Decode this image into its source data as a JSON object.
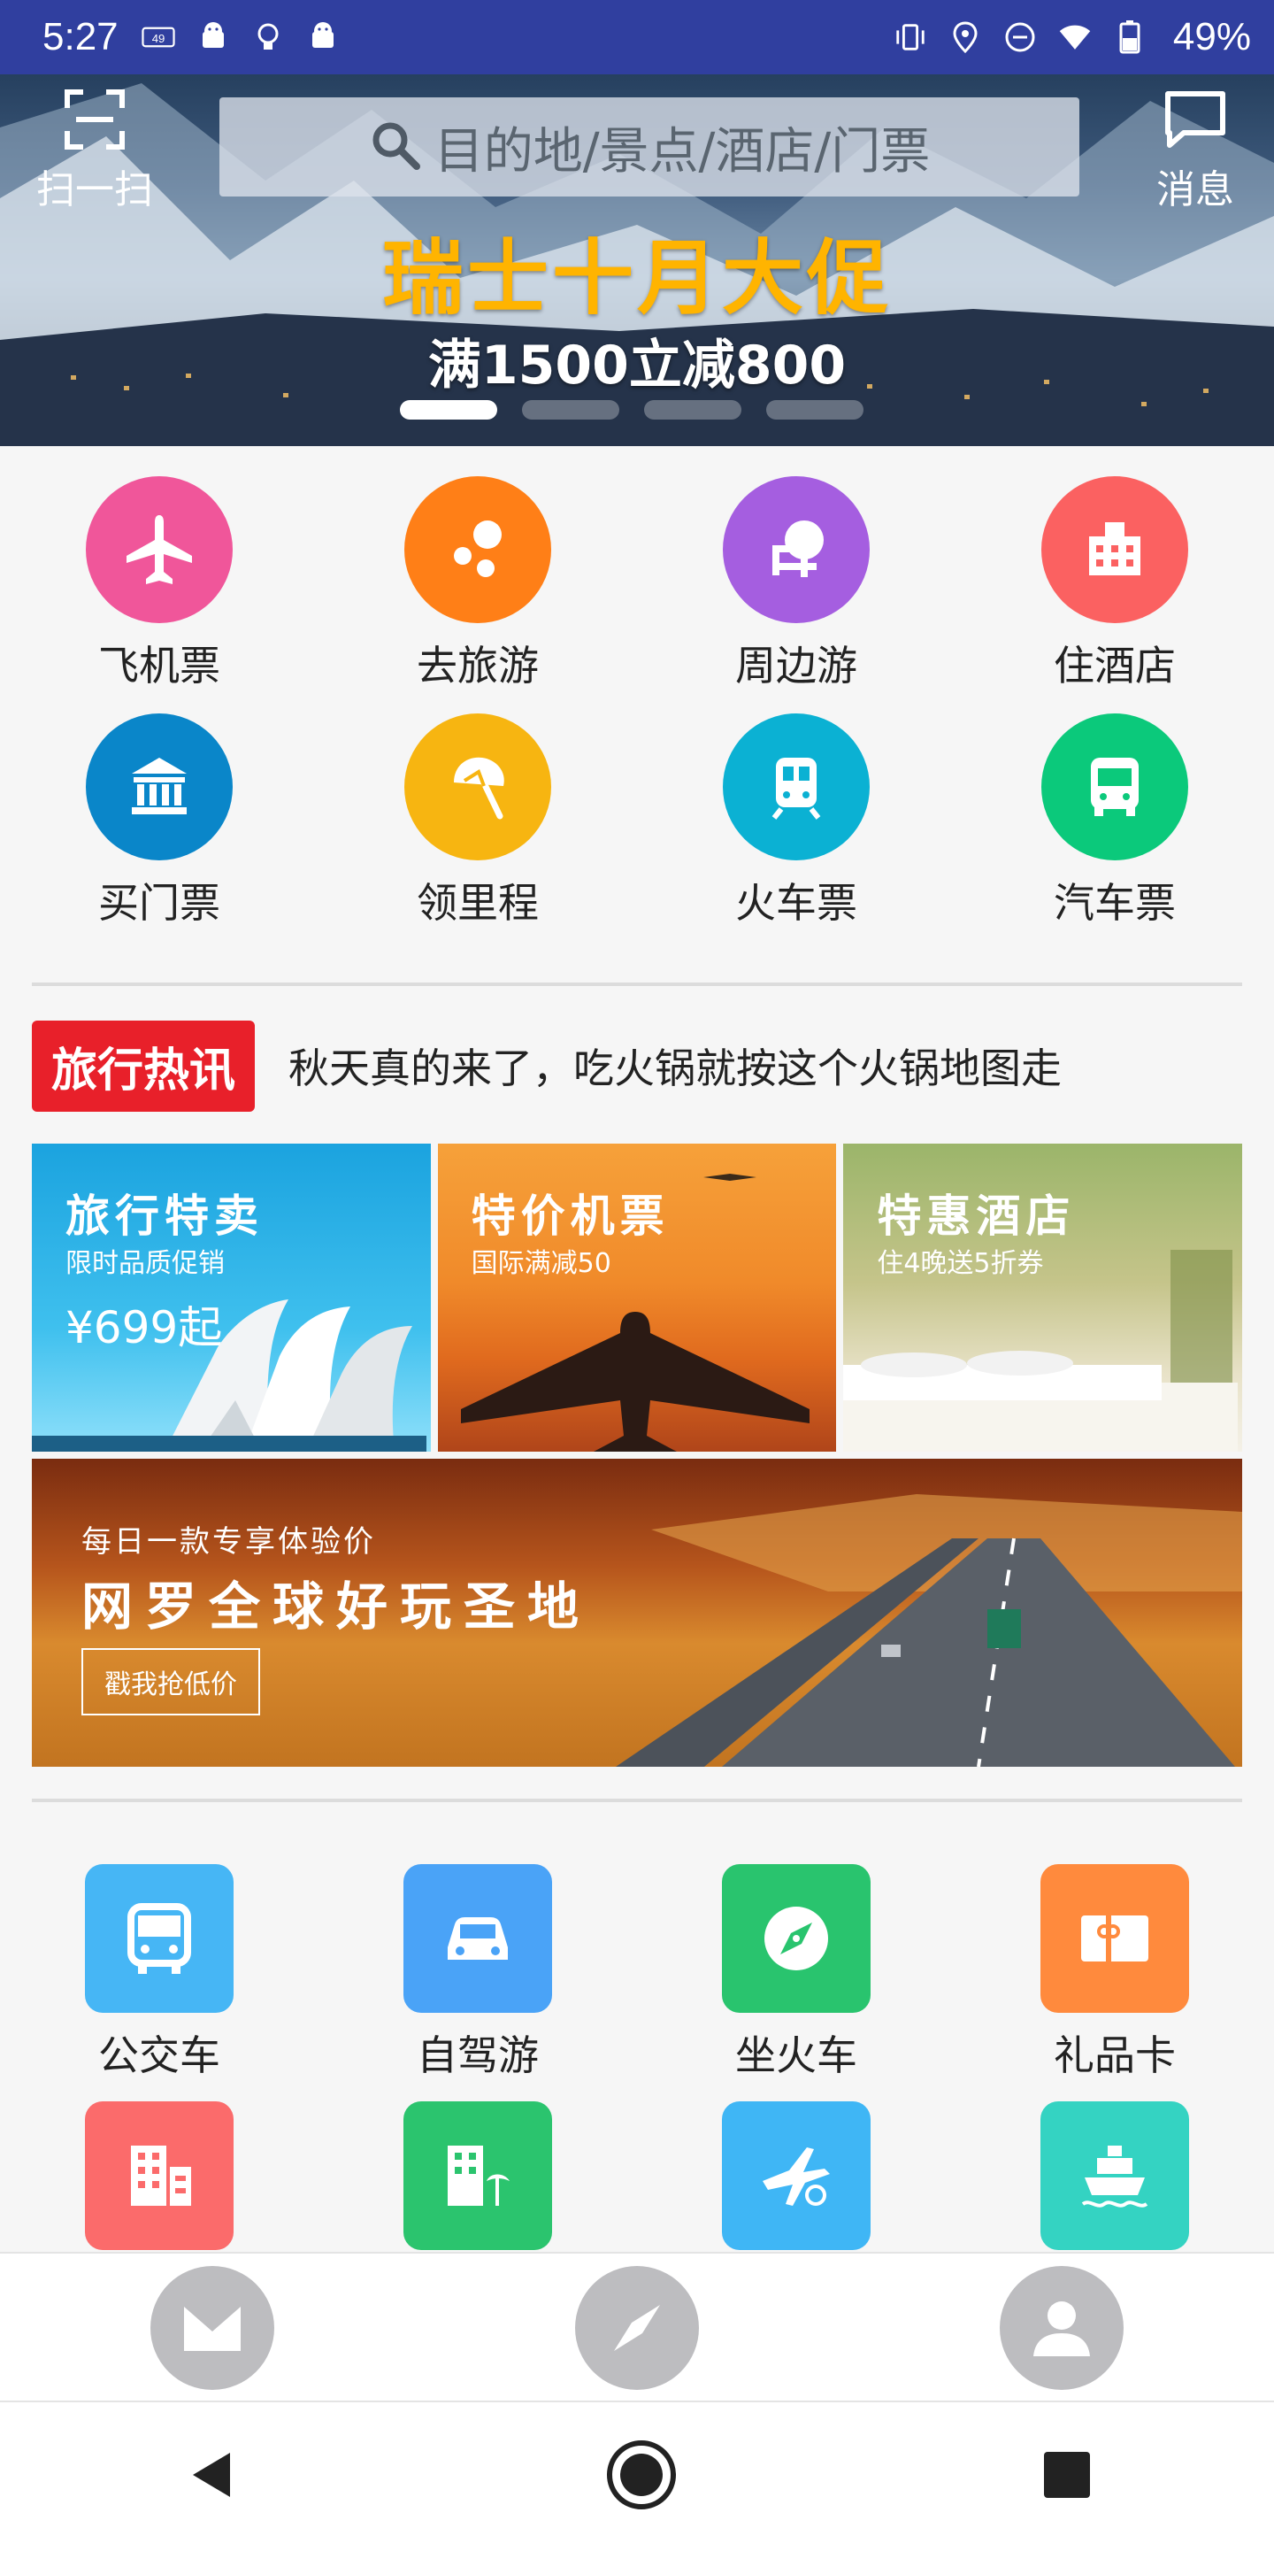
{
  "status_bar": {
    "time": "5:27",
    "battery": "49%"
  },
  "header": {
    "scan_label": "扫一扫",
    "message_label": "消息",
    "search_placeholder": "目的地/景点/酒店/门票"
  },
  "banner": {
    "title": "瑞士十月大促",
    "subtitle": "满1500立减800",
    "page_count": 4,
    "active_page": 1
  },
  "categories": [
    {
      "label": "飞机票",
      "icon": "airplane-icon",
      "color": "#f0569a"
    },
    {
      "label": "去旅游",
      "icon": "bubbles-icon",
      "color": "#ff7f17"
    },
    {
      "label": "周边游",
      "icon": "tree-icon",
      "color": "#a55ee0"
    },
    {
      "label": "住酒店",
      "icon": "hotel-icon",
      "color": "#fb6161"
    },
    {
      "label": "买门票",
      "icon": "museum-icon",
      "color": "#0a86c9"
    },
    {
      "label": "领里程",
      "icon": "beach-umbrella-icon",
      "color": "#f7b511"
    },
    {
      "label": "火车票",
      "icon": "train-icon",
      "color": "#0bb1d3"
    },
    {
      "label": "汽车票",
      "icon": "bus-icon",
      "color": "#0bc97b"
    }
  ],
  "news": {
    "tag": "旅行热讯",
    "headline": "秋天真的来了，吃火锅就按这个火锅地图走"
  },
  "promos": [
    {
      "title": "旅行特卖",
      "subtitle": "限时品质促销",
      "price": "¥699起"
    },
    {
      "title": "特价机票",
      "subtitle": "国际满减50"
    },
    {
      "title": "特惠酒店",
      "subtitle": "住4晚送5折券"
    }
  ],
  "wide_banner": {
    "line1": "每日一款专享体验价",
    "line2": "网罗全球好玩圣地",
    "button": "戳我抢低价"
  },
  "services": [
    {
      "label": "公交车",
      "icon": "bus-icon",
      "color": "#46b6f5"
    },
    {
      "label": "自驾游",
      "icon": "car-icon",
      "color": "#4aa3f7"
    },
    {
      "label": "坐火车",
      "icon": "compass-icon",
      "color": "#29c46e"
    },
    {
      "label": "礼品卡",
      "icon": "gift-card-icon",
      "color": "#ff8a3d"
    },
    {
      "label": "",
      "icon": "building-icon",
      "color": "#fb6b6b"
    },
    {
      "label": "",
      "icon": "resort-icon",
      "color": "#2bc46e"
    },
    {
      "label": "",
      "icon": "flight-global-icon",
      "color": "#3fb6f5"
    },
    {
      "label": "",
      "icon": "cruise-icon",
      "color": "#34d3c2"
    }
  ],
  "bottom_nav": [
    {
      "icon": "mail-icon"
    },
    {
      "icon": "compass-icon"
    },
    {
      "icon": "user-icon"
    }
  ]
}
